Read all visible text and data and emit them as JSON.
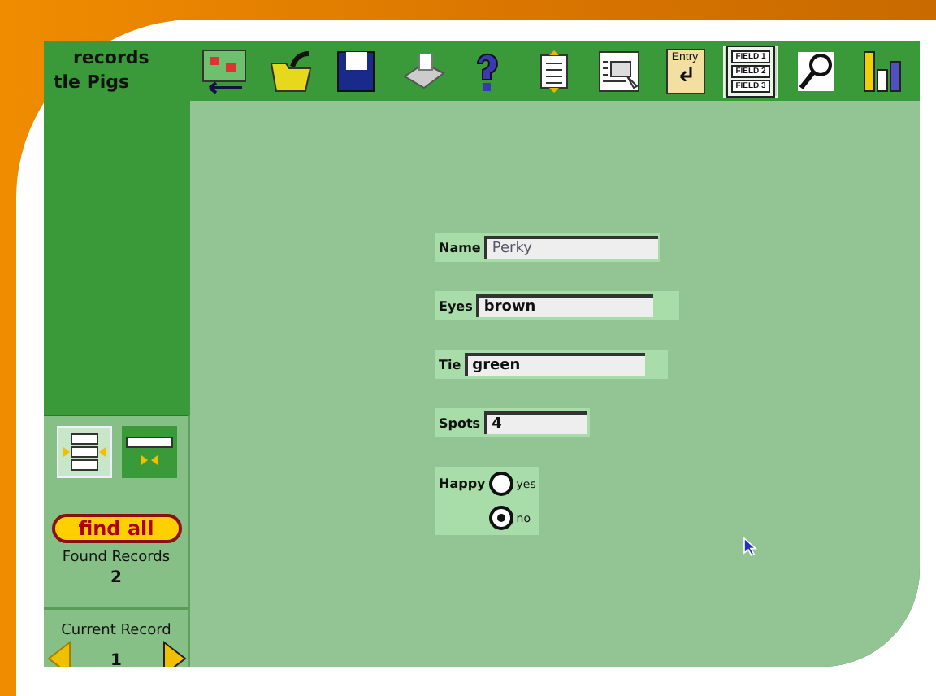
{
  "title_lines": [
    "records",
    "tle Pigs"
  ],
  "toolbar": [
    {
      "kind": "layout",
      "selected": false
    },
    {
      "kind": "open",
      "selected": false
    },
    {
      "kind": "save",
      "selected": false
    },
    {
      "kind": "print",
      "selected": false
    },
    {
      "kind": "help",
      "selected": false
    },
    {
      "kind": "sort",
      "selected": false
    },
    {
      "kind": "browse",
      "selected": false
    },
    {
      "kind": "entry",
      "selected": false,
      "label": "Entry"
    },
    {
      "kind": "fields",
      "selected": true,
      "labels": [
        "FIELD 1",
        "FIELD 2",
        "FIELD 3"
      ]
    },
    {
      "kind": "find",
      "selected": false
    },
    {
      "kind": "chart",
      "selected": false
    }
  ],
  "views": [
    {
      "kind": "form",
      "selected": true
    },
    {
      "kind": "list",
      "selected": false
    }
  ],
  "find_button": "find all",
  "found": {
    "label": "Found Records",
    "count": "2"
  },
  "current": {
    "label": "Current Record",
    "number": "1"
  },
  "fields": [
    {
      "kind": "text",
      "label": "Name",
      "value": "Perky",
      "bold": false
    },
    {
      "kind": "text",
      "label": "Eyes",
      "value": "brown",
      "bold": true
    },
    {
      "kind": "text",
      "label": "Tie",
      "value": "green",
      "bold": true
    },
    {
      "kind": "text",
      "label": "Spots",
      "value": "4",
      "bold": true
    },
    {
      "kind": "radio",
      "label": "Happy",
      "options": [
        {
          "label": "yes",
          "selected": false
        },
        {
          "label": "no",
          "selected": true
        }
      ]
    }
  ]
}
